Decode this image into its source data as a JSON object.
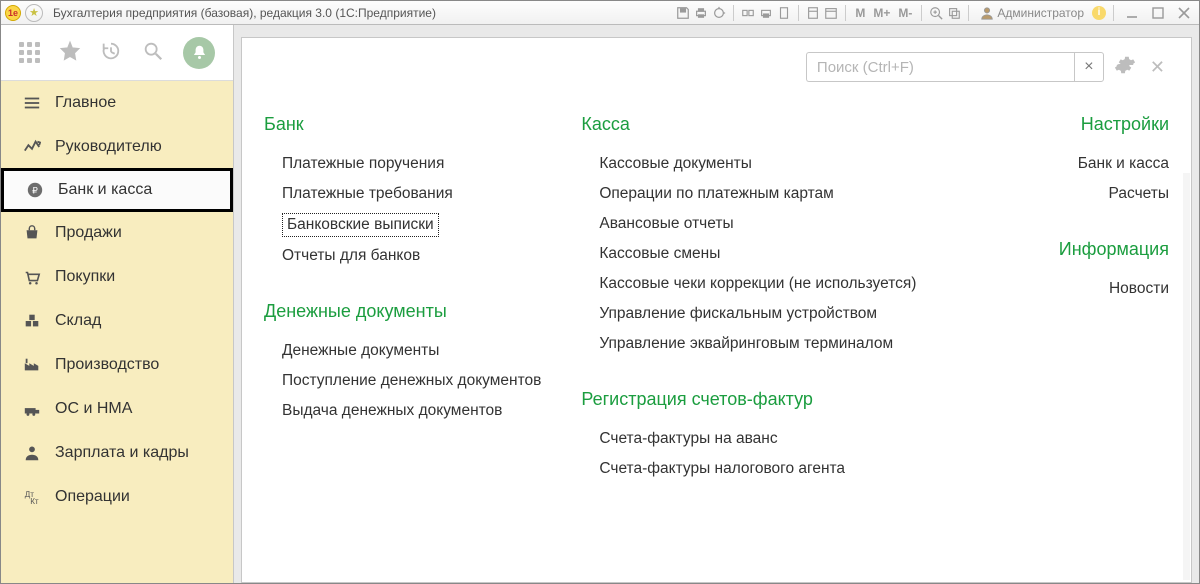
{
  "titlebar": {
    "app_title": "Бухгалтерия предприятия (базовая), редакция 3.0  (1С:Предприятие)",
    "m_label": "M",
    "mplus_label": "M+",
    "mminus_label": "M-",
    "user_label": "Администратор"
  },
  "sidebar": {
    "items": [
      {
        "label": "Главное"
      },
      {
        "label": "Руководителю"
      },
      {
        "label": "Банк и касса"
      },
      {
        "label": "Продажи"
      },
      {
        "label": "Покупки"
      },
      {
        "label": "Склад"
      },
      {
        "label": "Производство"
      },
      {
        "label": "ОС и НМА"
      },
      {
        "label": "Зарплата и кадры"
      },
      {
        "label": "Операции"
      }
    ]
  },
  "main": {
    "search_placeholder": "Поиск (Ctrl+F)",
    "clear_label": "×",
    "sections": {
      "bank": {
        "title": "Банк",
        "items": [
          "Платежные поручения",
          "Платежные требования",
          "Банковские выписки",
          "Отчеты для банков"
        ]
      },
      "dendoc": {
        "title": "Денежные документы",
        "items": [
          "Денежные документы",
          "Поступление денежных документов",
          "Выдача денежных документов"
        ]
      },
      "kassa": {
        "title": "Касса",
        "items": [
          "Кассовые документы",
          "Операции по платежным картам",
          "Авансовые отчеты",
          "Кассовые смены",
          "Кассовые чеки коррекции (не используется)",
          "Управление фискальным устройством",
          "Управление эквайринговым терминалом"
        ]
      },
      "regsf": {
        "title": "Регистрация счетов-фактур",
        "items": [
          "Счета-фактуры на аванс",
          "Счета-фактуры налогового агента"
        ]
      },
      "settings": {
        "title": "Настройки",
        "items": [
          "Банк и касса",
          "Расчеты"
        ]
      },
      "info": {
        "title": "Информация",
        "items": [
          "Новости"
        ]
      }
    }
  }
}
